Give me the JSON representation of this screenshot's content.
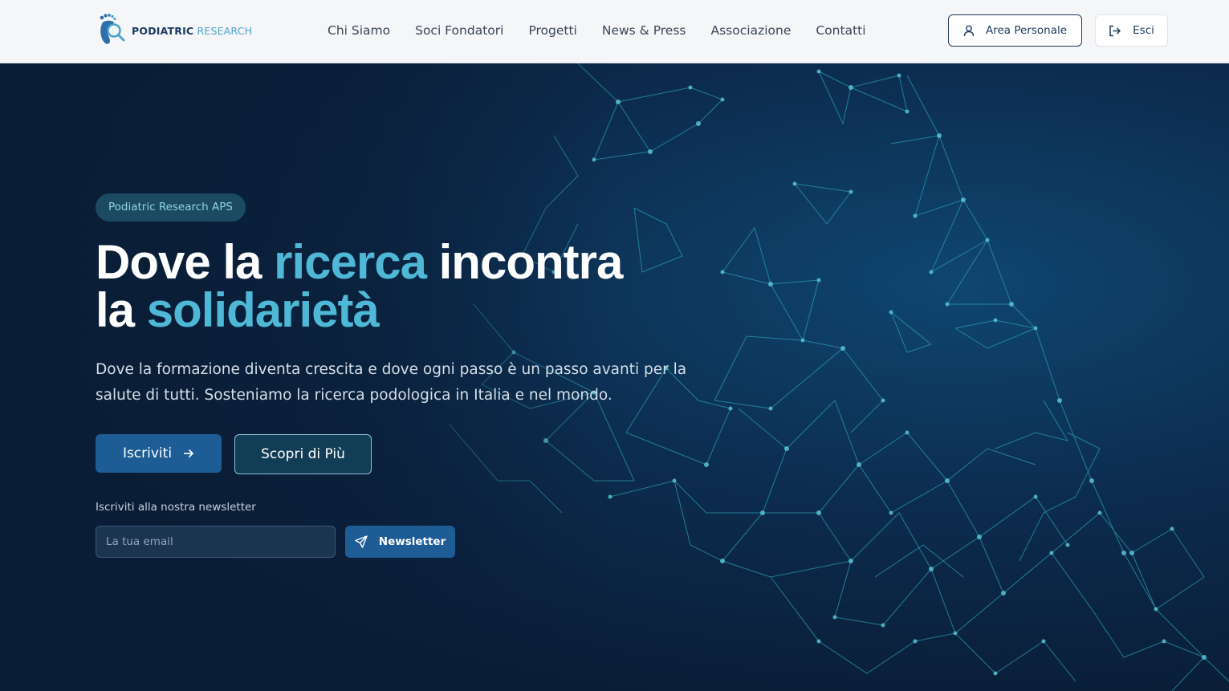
{
  "header": {
    "logo": {
      "bold": "PODIATRIC",
      "light": " RESEARCH"
    },
    "nav": [
      {
        "label": "Chi Siamo"
      },
      {
        "label": "Soci Fondatori"
      },
      {
        "label": "Progetti"
      },
      {
        "label": "News & Press"
      },
      {
        "label": "Associazione"
      },
      {
        "label": "Contatti"
      }
    ],
    "area_personale": "Area Personale",
    "esci": "Esci"
  },
  "hero": {
    "badge": "Podiatric Research APS",
    "headline": {
      "part1": "Dove la ",
      "accent1": "ricerca",
      "part2": " incontra",
      "part3": "la ",
      "accent2": "solidarietà"
    },
    "subtext": "Dove la formazione diventa crescita e dove ogni passo è un passo avanti per la salute di tutti. Sosteniamo la ricerca podologica in Italia e nel mondo.",
    "cta_primary": "Iscriviti",
    "cta_secondary": "Scopri di Più",
    "newsletter_label": "Iscriviti alla nostra newsletter",
    "email_placeholder": "La tua email",
    "newsletter_button": "Newsletter"
  },
  "colors": {
    "brand_dark": "#1d3a5f",
    "accent": "#4fb8d6",
    "hero_bg": "#0b2440",
    "primary_button": "#1e5c95"
  },
  "icons": {
    "logo": "foot-magnifier-logo",
    "area": "user-icon",
    "esci": "logout-icon",
    "cta": "arrow-right-icon",
    "newsletter": "send-icon"
  }
}
